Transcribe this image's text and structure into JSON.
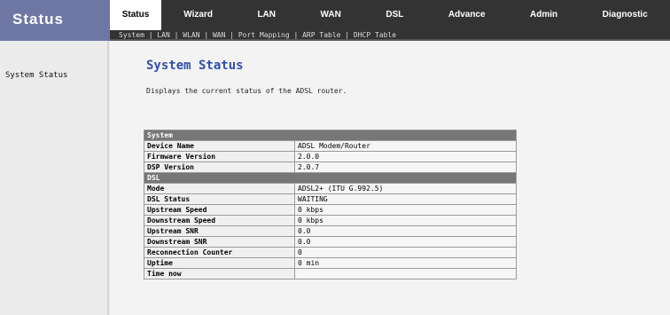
{
  "logo": "Status",
  "nav": {
    "tabs": [
      {
        "label": "Status",
        "active": true
      },
      {
        "label": "Wizard",
        "active": false
      },
      {
        "label": "LAN",
        "active": false
      },
      {
        "label": "WAN",
        "active": false
      },
      {
        "label": "DSL",
        "active": false
      },
      {
        "label": "Advance",
        "active": false
      },
      {
        "label": "Admin",
        "active": false
      },
      {
        "label": "Diagnostic",
        "active": false
      }
    ],
    "subnav": "System | LAN | WLAN | WAN | Port Mapping | ARP Table | DHCP Table"
  },
  "sidebar": {
    "items": [
      "System Status"
    ]
  },
  "page": {
    "title": "System Status",
    "description": "Displays the current status of the ADSL router."
  },
  "table": {
    "system_header": "System",
    "device_name_label": "Device Name",
    "device_name_value": "ADSL Modem/Router",
    "firmware_label": "Firmware Version",
    "firmware_value": "2.0.0",
    "dsp_label": "DSP Version",
    "dsp_value": "2.0.7",
    "dsl_header": "DSL",
    "mode_label": "Mode",
    "mode_value": "ADSL2+ (ITU G.992.5)",
    "dsl_status_label": "DSL Status",
    "dsl_status_value": "WAITING",
    "up_speed_label": "Upstream Speed",
    "up_speed_value": "0 kbps",
    "down_speed_label": "Downstream Speed",
    "down_speed_value": "0 kbps",
    "up_snr_label": "Upstream SNR",
    "up_snr_value": "0.0",
    "down_snr_label": "Downstream SNR",
    "down_snr_value": "0.0",
    "reconnect_label": "Reconnection Counter",
    "reconnect_value": "0",
    "uptime_label": "Uptime",
    "uptime_value": "0 min",
    "last_label": "Time now",
    "last_value": ""
  }
}
